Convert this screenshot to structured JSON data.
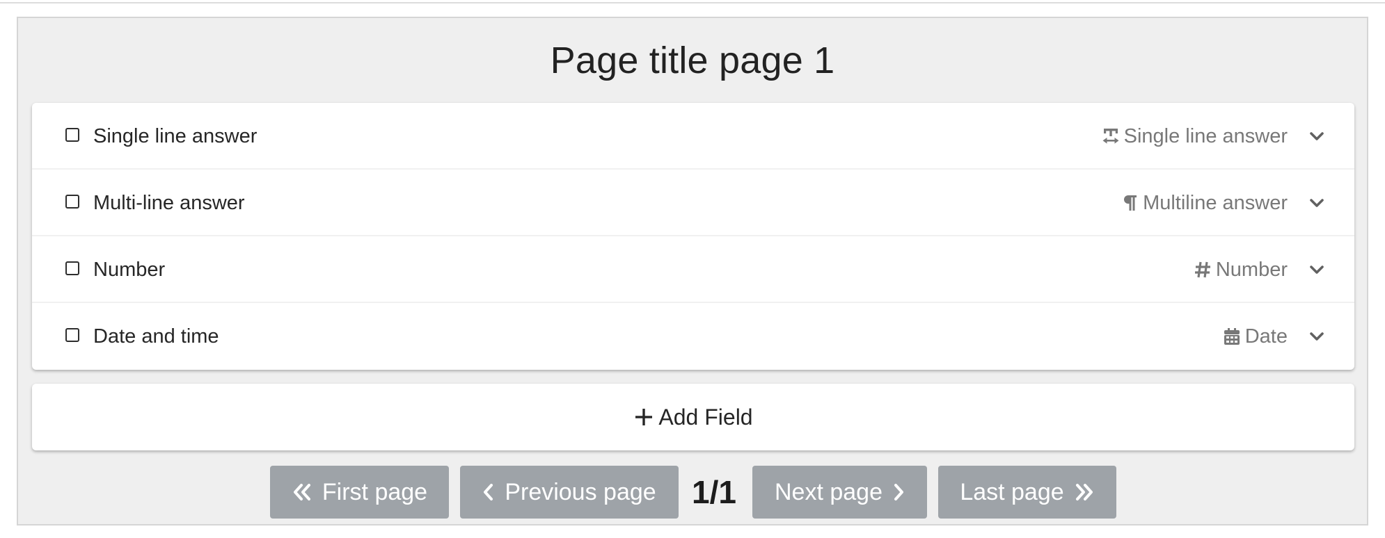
{
  "page": {
    "title": "Page title page 1"
  },
  "fields": [
    {
      "label": "Single line answer",
      "type_label": "Single line answer",
      "type_icon": "text-width-icon"
    },
    {
      "label": "Multi-line answer",
      "type_label": "Multiline answer",
      "type_icon": "paragraph-icon"
    },
    {
      "label": "Number",
      "type_label": "Number",
      "type_icon": "hashtag-icon"
    },
    {
      "label": "Date and time",
      "type_label": "Date",
      "type_icon": "calendar-icon"
    }
  ],
  "add_field": {
    "label": "Add Field",
    "icon": "plus-icon"
  },
  "pagination": {
    "first_label": "First page",
    "previous_label": "Previous page",
    "indicator": "1/1",
    "next_label": "Next page",
    "last_label": "Last page"
  },
  "colors": {
    "panel_background": "#efefef",
    "card_background": "#ffffff",
    "pager_button": "#9ea3a8",
    "muted_text": "#787878"
  }
}
